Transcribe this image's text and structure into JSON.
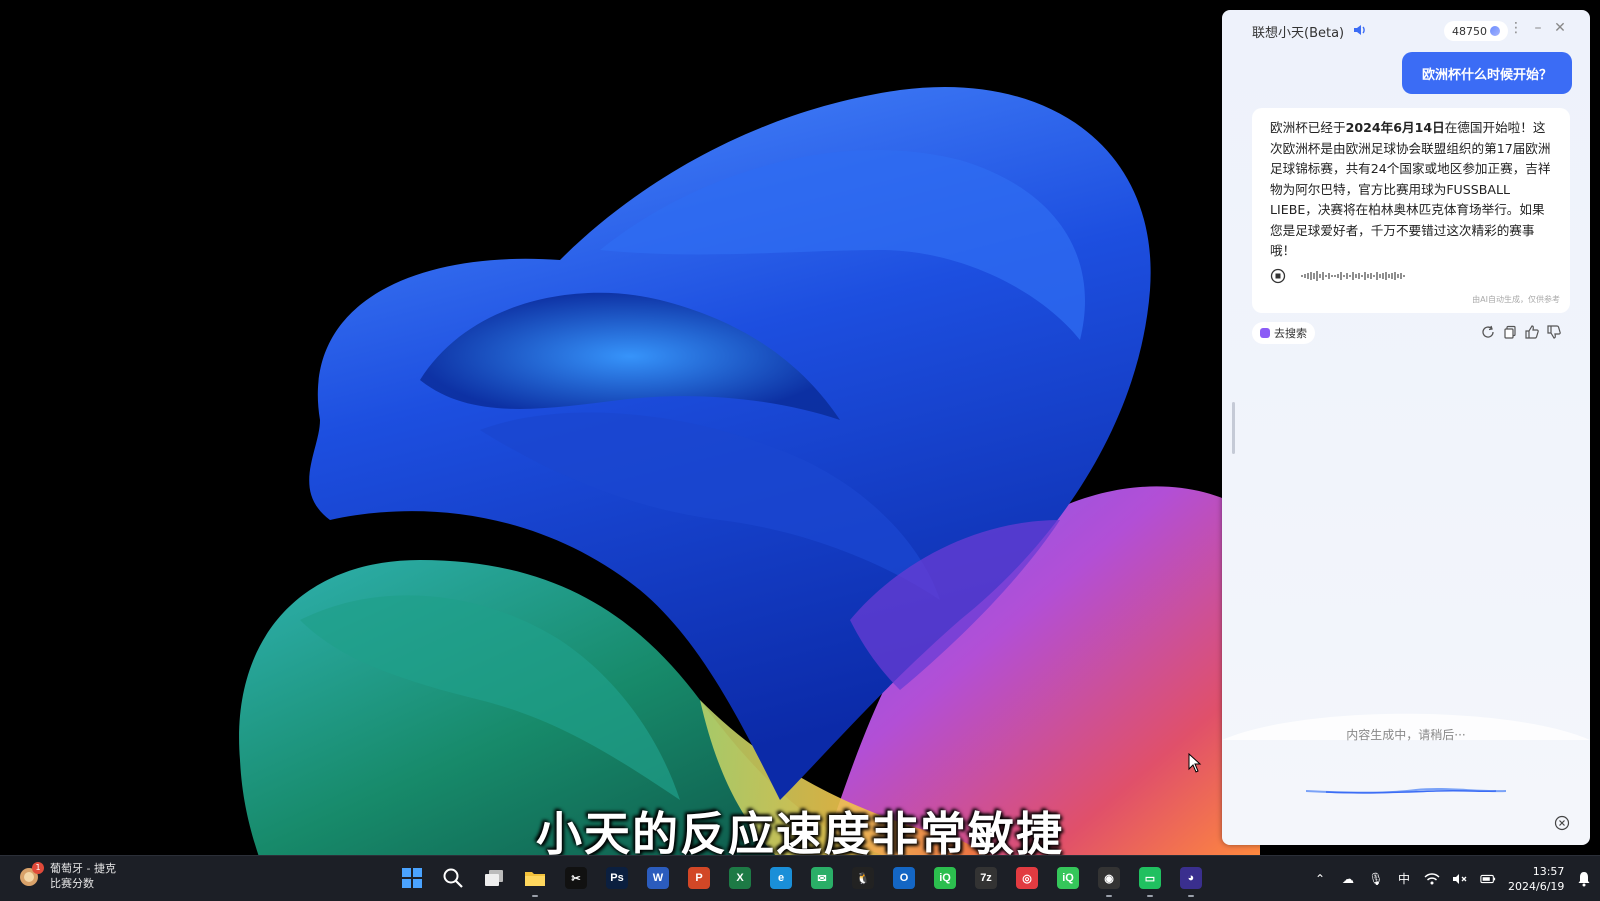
{
  "subtitle": "小天的反应速度非常敏捷",
  "assistant": {
    "title": "联想小天(Beta)",
    "score": "48750",
    "user_question": "欧洲杯什么时候开始？",
    "answer": {
      "part1": "欧洲杯已经于",
      "date_bold": "2024年6月14日",
      "part2": "在德国开始啦！这次欧洲杯是由欧洲足球协会联盟组织的第17届欧洲足球锦标赛，共有24个国家或地区参加正赛，吉祥物为阿尔巴特，官方比赛用球为FUSSBALL LIEBE，决赛将在柏林奥林匹克体育场举行。如果您是足球爱好者，千万不要错过这次精彩的赛事哦！"
    },
    "ai_note": "由AI自动生成，仅供参考",
    "search_chip": "去搜索",
    "status": "内容生成中，请稍后···",
    "icons": [
      "speaker-icon",
      "more-icon",
      "minimize-icon",
      "close-icon",
      "stop-icon",
      "refresh-icon",
      "copy-icon",
      "thumbs-up-icon",
      "thumbs-down-icon",
      "close-circle-icon"
    ]
  },
  "taskbar": {
    "weather_badge": "1",
    "weather_line1": "葡萄牙 - 捷克",
    "weather_line2": "比赛分数",
    "apps": [
      {
        "name": "start",
        "glyph": "",
        "color": "#2f8cff"
      },
      {
        "name": "search",
        "glyph": "",
        "color": "transparent"
      },
      {
        "name": "task-view",
        "glyph": "",
        "color": "transparent"
      },
      {
        "name": "file-explorer",
        "glyph": "",
        "color": "#f3c23c"
      },
      {
        "name": "capcut",
        "glyph": "✂",
        "color": "#111111"
      },
      {
        "name": "photoshop",
        "glyph": "Ps",
        "color": "#0b1f3f"
      },
      {
        "name": "word",
        "glyph": "W",
        "color": "#2b5cbd"
      },
      {
        "name": "powerpoint",
        "glyph": "P",
        "color": "#d24726"
      },
      {
        "name": "excel",
        "glyph": "X",
        "color": "#1d7a45"
      },
      {
        "name": "edge",
        "glyph": "e",
        "color": "#1a8fd8"
      },
      {
        "name": "wechat",
        "glyph": "✉",
        "color": "#2aae67"
      },
      {
        "name": "qq",
        "glyph": "🐧",
        "color": "#222222"
      },
      {
        "name": "outlook",
        "glyph": "O",
        "color": "#1466c4"
      },
      {
        "name": "iqiyi-green",
        "glyph": "iQ",
        "color": "#2cbe4e"
      },
      {
        "name": "7zip",
        "glyph": "7z",
        "color": "#333333"
      },
      {
        "name": "netease-music",
        "glyph": "◎",
        "color": "#e23b41"
      },
      {
        "name": "iqiyi",
        "glyph": "iQ",
        "color": "#35c65a"
      },
      {
        "name": "obs",
        "glyph": "◉",
        "color": "#333333"
      },
      {
        "name": "green-app",
        "glyph": "▭",
        "color": "#20c060"
      },
      {
        "name": "assistant-app",
        "glyph": "◕",
        "color": "#3a2f8e"
      }
    ],
    "ime": "中",
    "time": "13:57",
    "date": "2024/6/19"
  },
  "colors": {
    "accent": "#3b6cf5",
    "taskbar": "#1c1f26"
  }
}
